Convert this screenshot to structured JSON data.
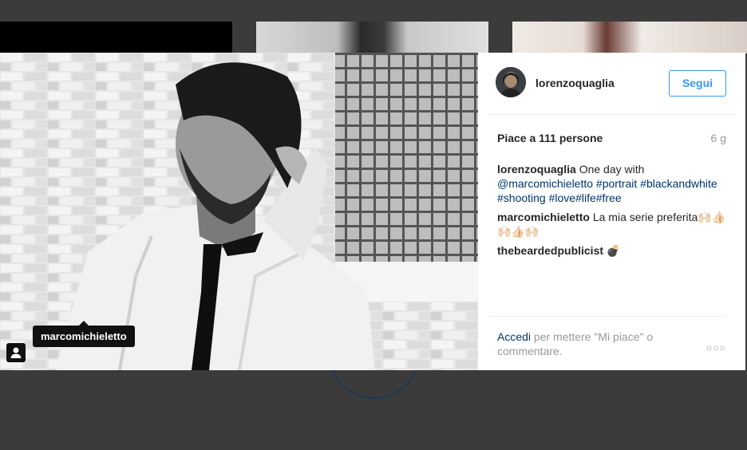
{
  "post": {
    "username": "lorenzoquaglia",
    "follow_label": "Segui",
    "likes": "Piace a 111 persone",
    "age": "6 g",
    "photo_tag": "marcomichieletto"
  },
  "comments": [
    {
      "user": "lorenzoquaglia",
      "text_plain": "One day with",
      "mention": "@marcomichieletto",
      "hashtags": "#portrait #blackandwhite #shooting #love#life#free"
    },
    {
      "user": "marcomichieletto",
      "text": "La mia serie preferita🙌🏻👍🏻🙌🏻👍🏻🙌🏻"
    },
    {
      "user": "thebeardedpublicist",
      "text": "💣"
    }
  ],
  "footer": {
    "login_link": "Accedi",
    "login_rest": "per mettere \"Mi piace\" o commentare.",
    "more_icon": "ellipsis-icon"
  }
}
